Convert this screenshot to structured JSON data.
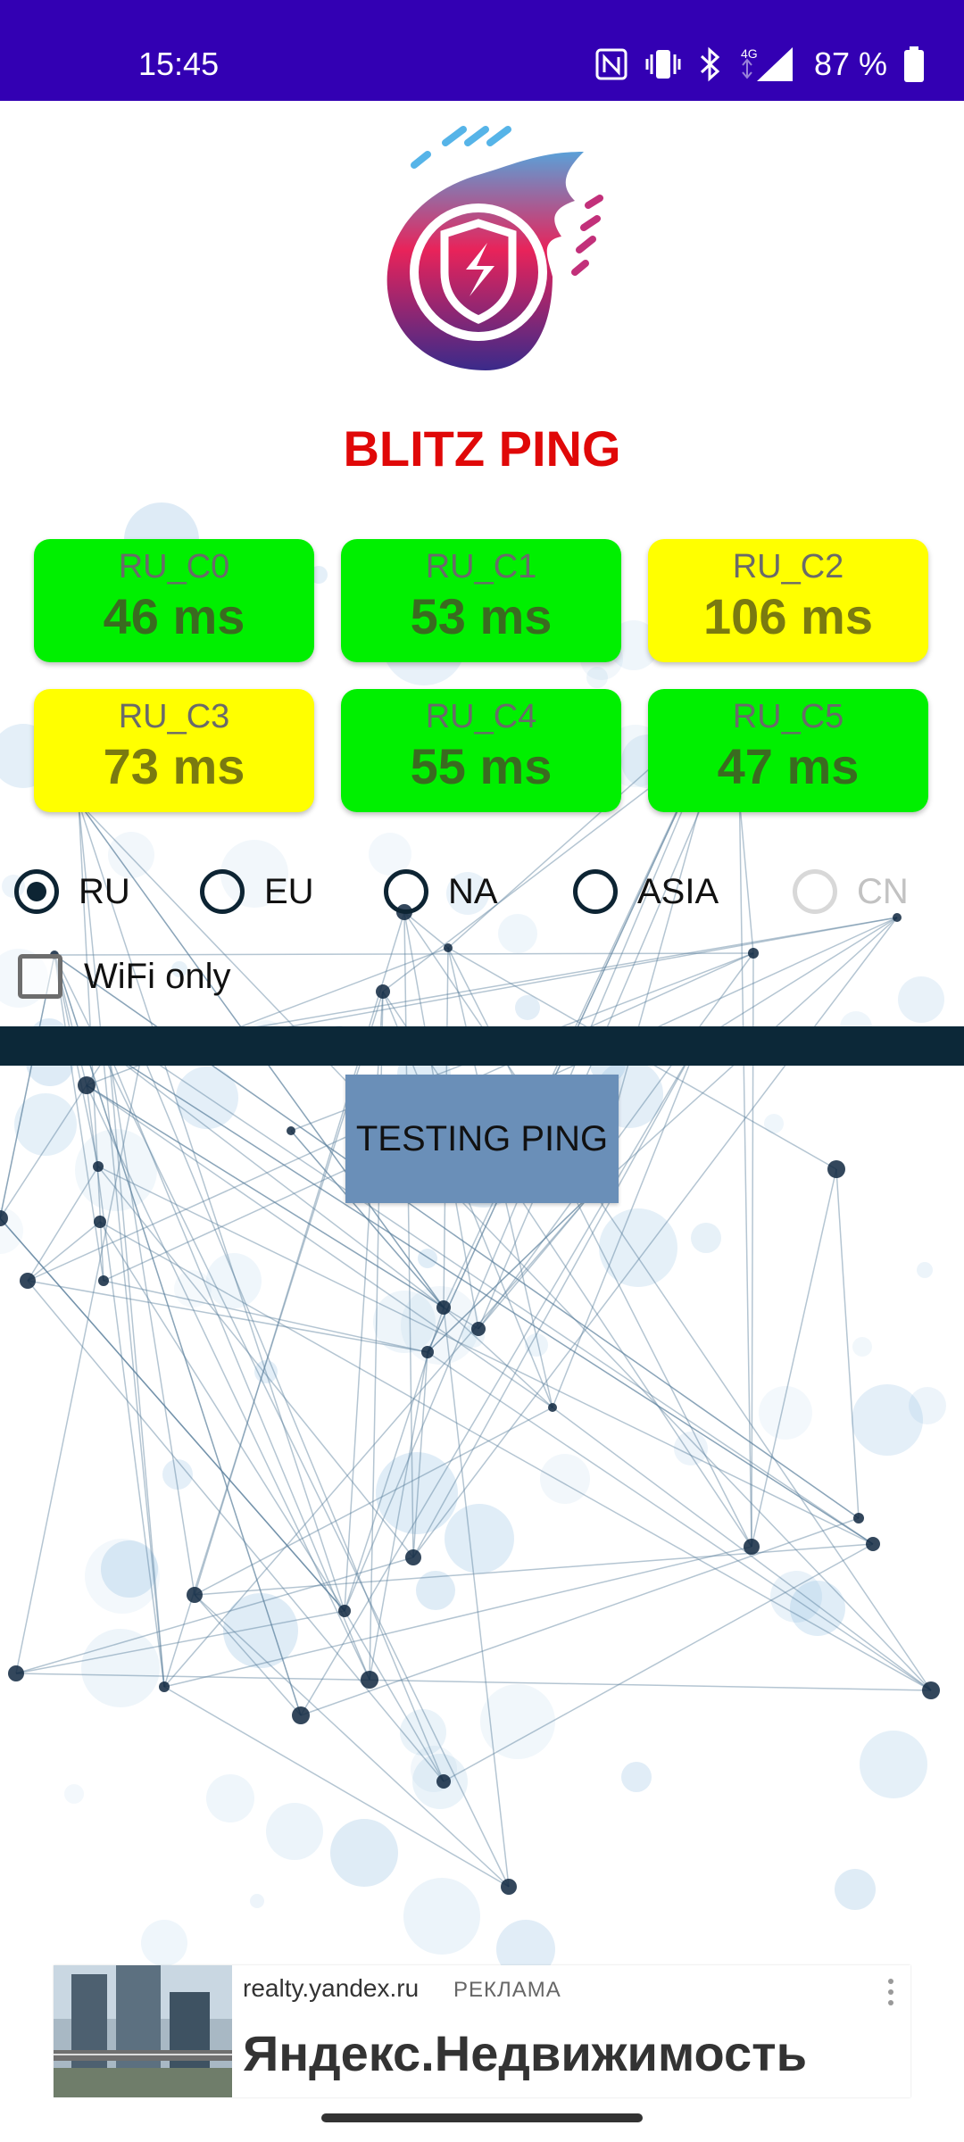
{
  "status_bar": {
    "time": "15:45",
    "battery": "87 %",
    "network": "4G",
    "icons": [
      "nfc-icon",
      "vibrate-icon",
      "bluetooth-icon",
      "signal-icon",
      "battery-icon"
    ]
  },
  "app": {
    "title": "BLITZ PING",
    "logo_icon": "blitz-ping-logo"
  },
  "colors": {
    "status_bar": "#3300b3",
    "title": "#e00808",
    "good": "#00f000",
    "warn": "#ffff00",
    "divider": "#0c2838",
    "button": "#6a8fb8"
  },
  "servers": [
    {
      "name": "RU_C0",
      "ping": "46 ms",
      "status": "good"
    },
    {
      "name": "RU_C1",
      "ping": "53 ms",
      "status": "good"
    },
    {
      "name": "RU_C2",
      "ping": "106 ms",
      "status": "warn"
    },
    {
      "name": "RU_C3",
      "ping": "73 ms",
      "status": "warn"
    },
    {
      "name": "RU_C4",
      "ping": "55 ms",
      "status": "good"
    },
    {
      "name": "RU_C5",
      "ping": "47 ms",
      "status": "good"
    }
  ],
  "regions": [
    {
      "label": "RU",
      "checked": true,
      "enabled": true
    },
    {
      "label": "EU",
      "checked": false,
      "enabled": true
    },
    {
      "label": "NA",
      "checked": false,
      "enabled": true
    },
    {
      "label": "ASIA",
      "checked": false,
      "enabled": true
    },
    {
      "label": "CN",
      "checked": false,
      "enabled": false
    }
  ],
  "wifi_only": {
    "label": "WiFi only",
    "checked": false
  },
  "test_button": {
    "label": "TESTING PING"
  },
  "ad": {
    "domain": "realty.yandex.ru",
    "tag": "РЕКЛАМА",
    "title": "Яндекс.Недвижимость",
    "menu_icon": "more-vert-icon"
  }
}
